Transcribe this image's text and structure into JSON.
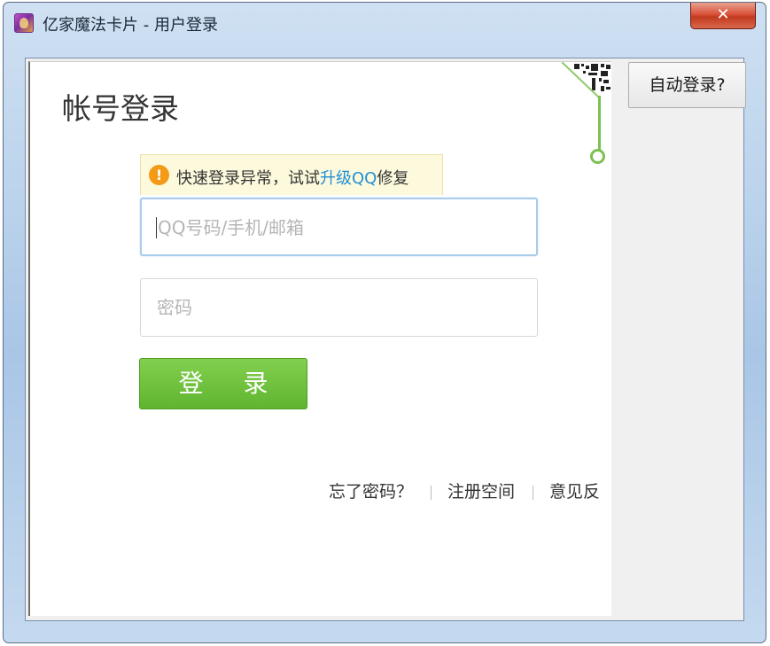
{
  "window": {
    "title": "亿家魔法卡片 - 用户登录",
    "close_label": "✕"
  },
  "login": {
    "title": "帐号登录",
    "warning": {
      "prefix": "快速登录异常，试试",
      "link": "升级QQ",
      "suffix": "修复"
    },
    "account_placeholder": "QQ号码/手机/邮箱",
    "password_placeholder": "密码",
    "submit_label": "登 录"
  },
  "footer": {
    "forgot_password": "忘了密码？",
    "register": "注册空间",
    "feedback": "意见反"
  },
  "side": {
    "auto_login_label": "自动登录?"
  },
  "colors": {
    "accent_green": "#5fb52f",
    "link_blue": "#1f8fd6",
    "warning_orange": "#f39a16"
  }
}
